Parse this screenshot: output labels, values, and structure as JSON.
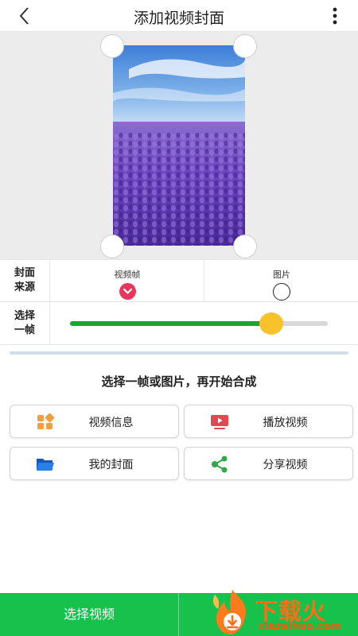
{
  "header": {
    "title": "添加视频封面",
    "back_icon": "chevron-left-icon",
    "more_icon": "more-vertical-icon"
  },
  "cover_source": {
    "label": "封面\n来源",
    "options": [
      {
        "label": "视频帧",
        "selected": true
      },
      {
        "label": "图片",
        "selected": false
      }
    ]
  },
  "frame_select": {
    "label": "选择\n一帧",
    "progress": 0.78
  },
  "hint": "选择一帧或图片，再开始合成",
  "actions": [
    {
      "label": "视频信息",
      "icon": "grid-icon",
      "color": "#f0a040"
    },
    {
      "label": "播放视频",
      "icon": "video-play-icon",
      "color": "#e24850"
    },
    {
      "label": "我的封面",
      "icon": "folder-icon",
      "color": "#1e6fd9"
    },
    {
      "label": "分享视频",
      "icon": "share-icon",
      "color": "#2ea84a"
    }
  ],
  "footer": {
    "select_video": "选择视频"
  },
  "watermark": {
    "name": "下载火",
    "site": "xiazaihuo.com"
  },
  "colors": {
    "accent_green": "#18c04c",
    "slider_green": "#1aa72e",
    "thumb_yellow": "#f7c22c",
    "selected_pink": "#e8375a"
  }
}
